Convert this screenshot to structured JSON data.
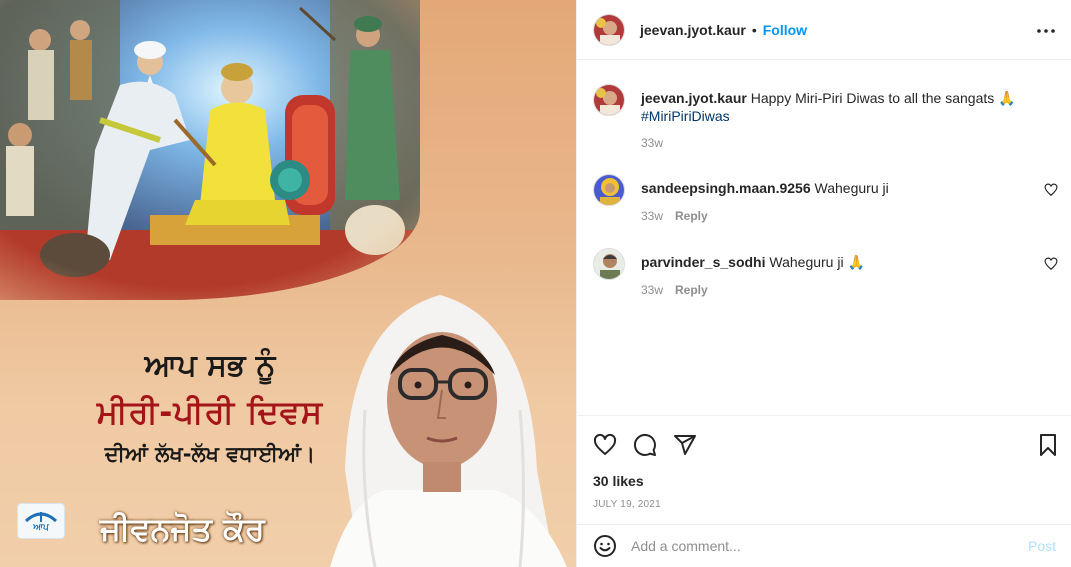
{
  "image": {
    "headline_line1": "ਆਪ ਸਭ ਨੂੰ",
    "headline_line2": "ਮੀਰੀ-ਪੀਰੀ ਦਿਵਸ",
    "headline_line3": "ਦੀਆਂ ਲੱਖ-ਲੱਖ ਵਧਾਈਆਂ।",
    "logo_text": "ਆਪ",
    "signature_name": "ਜੀਵਨਜੋਤ ਕੌਰ"
  },
  "header": {
    "username": "jeevan.jyot.kaur",
    "separator": "•",
    "follow_label": "Follow"
  },
  "caption": {
    "username": "jeevan.jyot.kaur",
    "text": "Happy Miri-Piri Diwas to all the sangats 🙏",
    "hashtag": "#MiriPiriDiwas",
    "time": "33w"
  },
  "comments": [
    {
      "username": "sandeepsingh.maan.9256",
      "text": "Waheguru ji",
      "time": "33w",
      "reply_label": "Reply"
    },
    {
      "username": "parvinder_s_sodhi",
      "text": "Waheguru ji 🙏",
      "time": "33w",
      "reply_label": "Reply"
    }
  ],
  "stats": {
    "likes": "30 likes",
    "date": "JULY 19, 2021"
  },
  "add_comment": {
    "placeholder": "Add a comment...",
    "post_label": "Post"
  },
  "colors": {
    "accent": "#0095f6",
    "post_disabled": "#b2dffc",
    "headline_red": "#a4151a"
  }
}
